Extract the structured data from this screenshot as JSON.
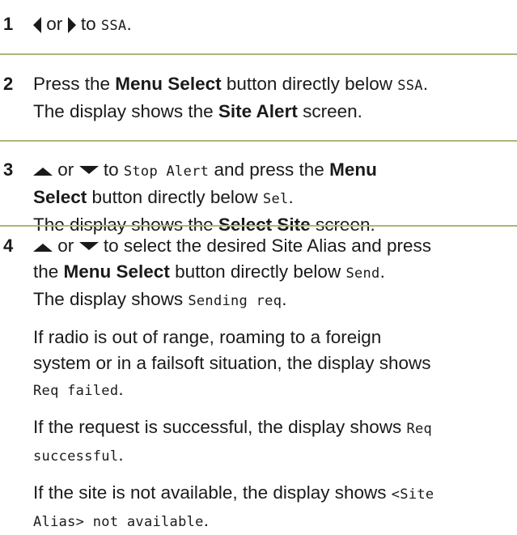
{
  "steps": [
    {
      "number": "1",
      "line1": {
        "or": "or",
        "to": "to",
        "mode": "SSA",
        "end": "."
      }
    },
    {
      "number": "2",
      "line1": {
        "pre": "Press the ",
        "button": "Menu Select",
        "mid": " button directly below ",
        "mode": "SSA",
        "end": "."
      },
      "line2": {
        "pre": "The display shows the ",
        "screen": "Site Alert",
        "post": " screen."
      }
    },
    {
      "number": "3",
      "line1": {
        "or": "or",
        "to": "to",
        "item": "Stop Alert",
        "mid": "and press the",
        "button_a": "Menu"
      },
      "line2": {
        "button_b": "Select",
        "mid": " button directly below ",
        "mode": "Sel",
        "end": "."
      },
      "line3": {
        "pre": "The display shows the ",
        "screen": "Select Site",
        "post": " screen."
      }
    },
    {
      "number": "4",
      "line1": {
        "or": "or",
        "text": "to select the desired Site Alias and press"
      },
      "line2": {
        "pre": "the ",
        "button": "Menu Select",
        "mid": " button directly below ",
        "mode": "Send",
        "end": "."
      },
      "line3": {
        "pre": "The display shows ",
        "msg": "Sending req",
        "end": "."
      },
      "para1": {
        "l1": "If radio is out of range, roaming to a foreign",
        "l2": "system or in a failsoft situation, the display shows",
        "msg": "Req failed",
        "end": "."
      },
      "para2": {
        "pre": "If the request is successful, the display shows ",
        "msg_a": "Req",
        "msg_b": "successful",
        "end": "."
      },
      "para3": {
        "pre": "If the site is not available, the display shows ",
        "msg_a": "<Site",
        "msg_b": "Alias> not available",
        "end": "."
      }
    }
  ],
  "icons": [
    "left-arrow-icon",
    "right-arrow-icon",
    "up-arrow-icon",
    "down-arrow-icon"
  ]
}
